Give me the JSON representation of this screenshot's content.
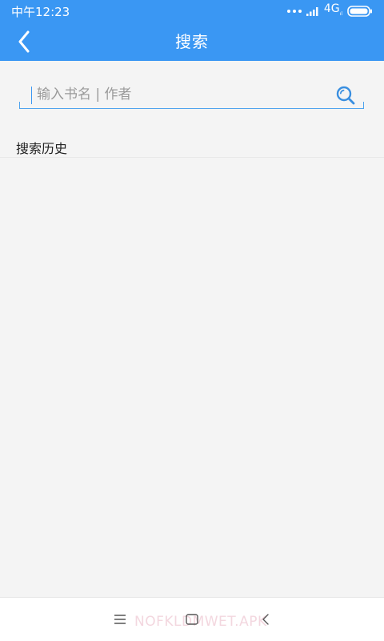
{
  "status_bar": {
    "time": "中午12:23",
    "network": "4G",
    "network_sub": "ıl"
  },
  "header": {
    "title": "搜索",
    "back_icon": "chevron-left-icon"
  },
  "search": {
    "placeholder": "输入书名 | 作者",
    "value": "",
    "icon": "search-icon"
  },
  "history": {
    "title": "搜索历史",
    "items": []
  },
  "nav_bar": {
    "menu_icon": "menu-icon",
    "home_icon": "home-icon",
    "back_icon": "back-icon",
    "watermark": "NOFKLDMWET.APK"
  },
  "colors": {
    "accent": "#3a97f3",
    "background": "#f4f4f4"
  }
}
